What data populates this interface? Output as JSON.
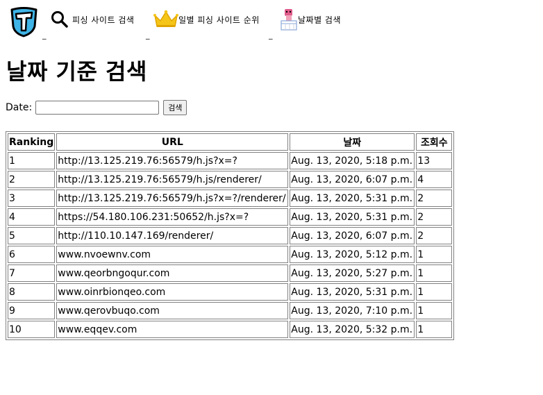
{
  "nav": {
    "items": [
      {
        "label": "피싱 사이트 검색",
        "icon": "search-icon"
      },
      {
        "label": "일별 피싱 사이트 순위",
        "icon": "crown-icon"
      },
      {
        "label": "날짜별 검색",
        "icon": "calendar-cake-icon"
      }
    ],
    "underscore": "_"
  },
  "page": {
    "title": "날짜 기준 검색"
  },
  "form": {
    "date_label": "Date:",
    "date_value": "",
    "search_label": "검색"
  },
  "table": {
    "headers": [
      "Ranking",
      "URL",
      "날짜",
      "조회수"
    ],
    "rows": [
      {
        "rank": "1",
        "url": "http://13.125.219.76:56579/h.js?x=?",
        "date": "Aug. 13, 2020, 5:18 p.m.",
        "views": "13"
      },
      {
        "rank": "2",
        "url": "http://13.125.219.76:56579/h.js/renderer/",
        "date": "Aug. 13, 2020, 6:07 p.m.",
        "views": "4"
      },
      {
        "rank": "3",
        "url": "http://13.125.219.76:56579/h.js?x=?/renderer/",
        "date": "Aug. 13, 2020, 5:31 p.m.",
        "views": "2"
      },
      {
        "rank": "4",
        "url": "https://54.180.106.231:50652/h.js?x=?",
        "date": "Aug. 13, 2020, 5:31 p.m.",
        "views": "2"
      },
      {
        "rank": "5",
        "url": "http://110.10.147.169/renderer/",
        "date": "Aug. 13, 2020, 6:07 p.m.",
        "views": "2"
      },
      {
        "rank": "6",
        "url": "www.nvoewnv.com",
        "date": "Aug. 13, 2020, 5:12 p.m.",
        "views": "1"
      },
      {
        "rank": "7",
        "url": "www.qeorbngoqur.com",
        "date": "Aug. 13, 2020, 5:27 p.m.",
        "views": "1"
      },
      {
        "rank": "8",
        "url": "www.oinrbionqeo.com",
        "date": "Aug. 13, 2020, 5:31 p.m.",
        "views": "1"
      },
      {
        "rank": "9",
        "url": "www.qerovbuqo.com",
        "date": "Aug. 13, 2020, 7:10 p.m.",
        "views": "1"
      },
      {
        "rank": "10",
        "url": "www.eqqev.com",
        "date": "Aug. 13, 2020, 5:32 p.m.",
        "views": "1"
      }
    ]
  },
  "colors": {
    "logo_blue": "#3fb4e6",
    "crown_gold": "#f5c518"
  }
}
